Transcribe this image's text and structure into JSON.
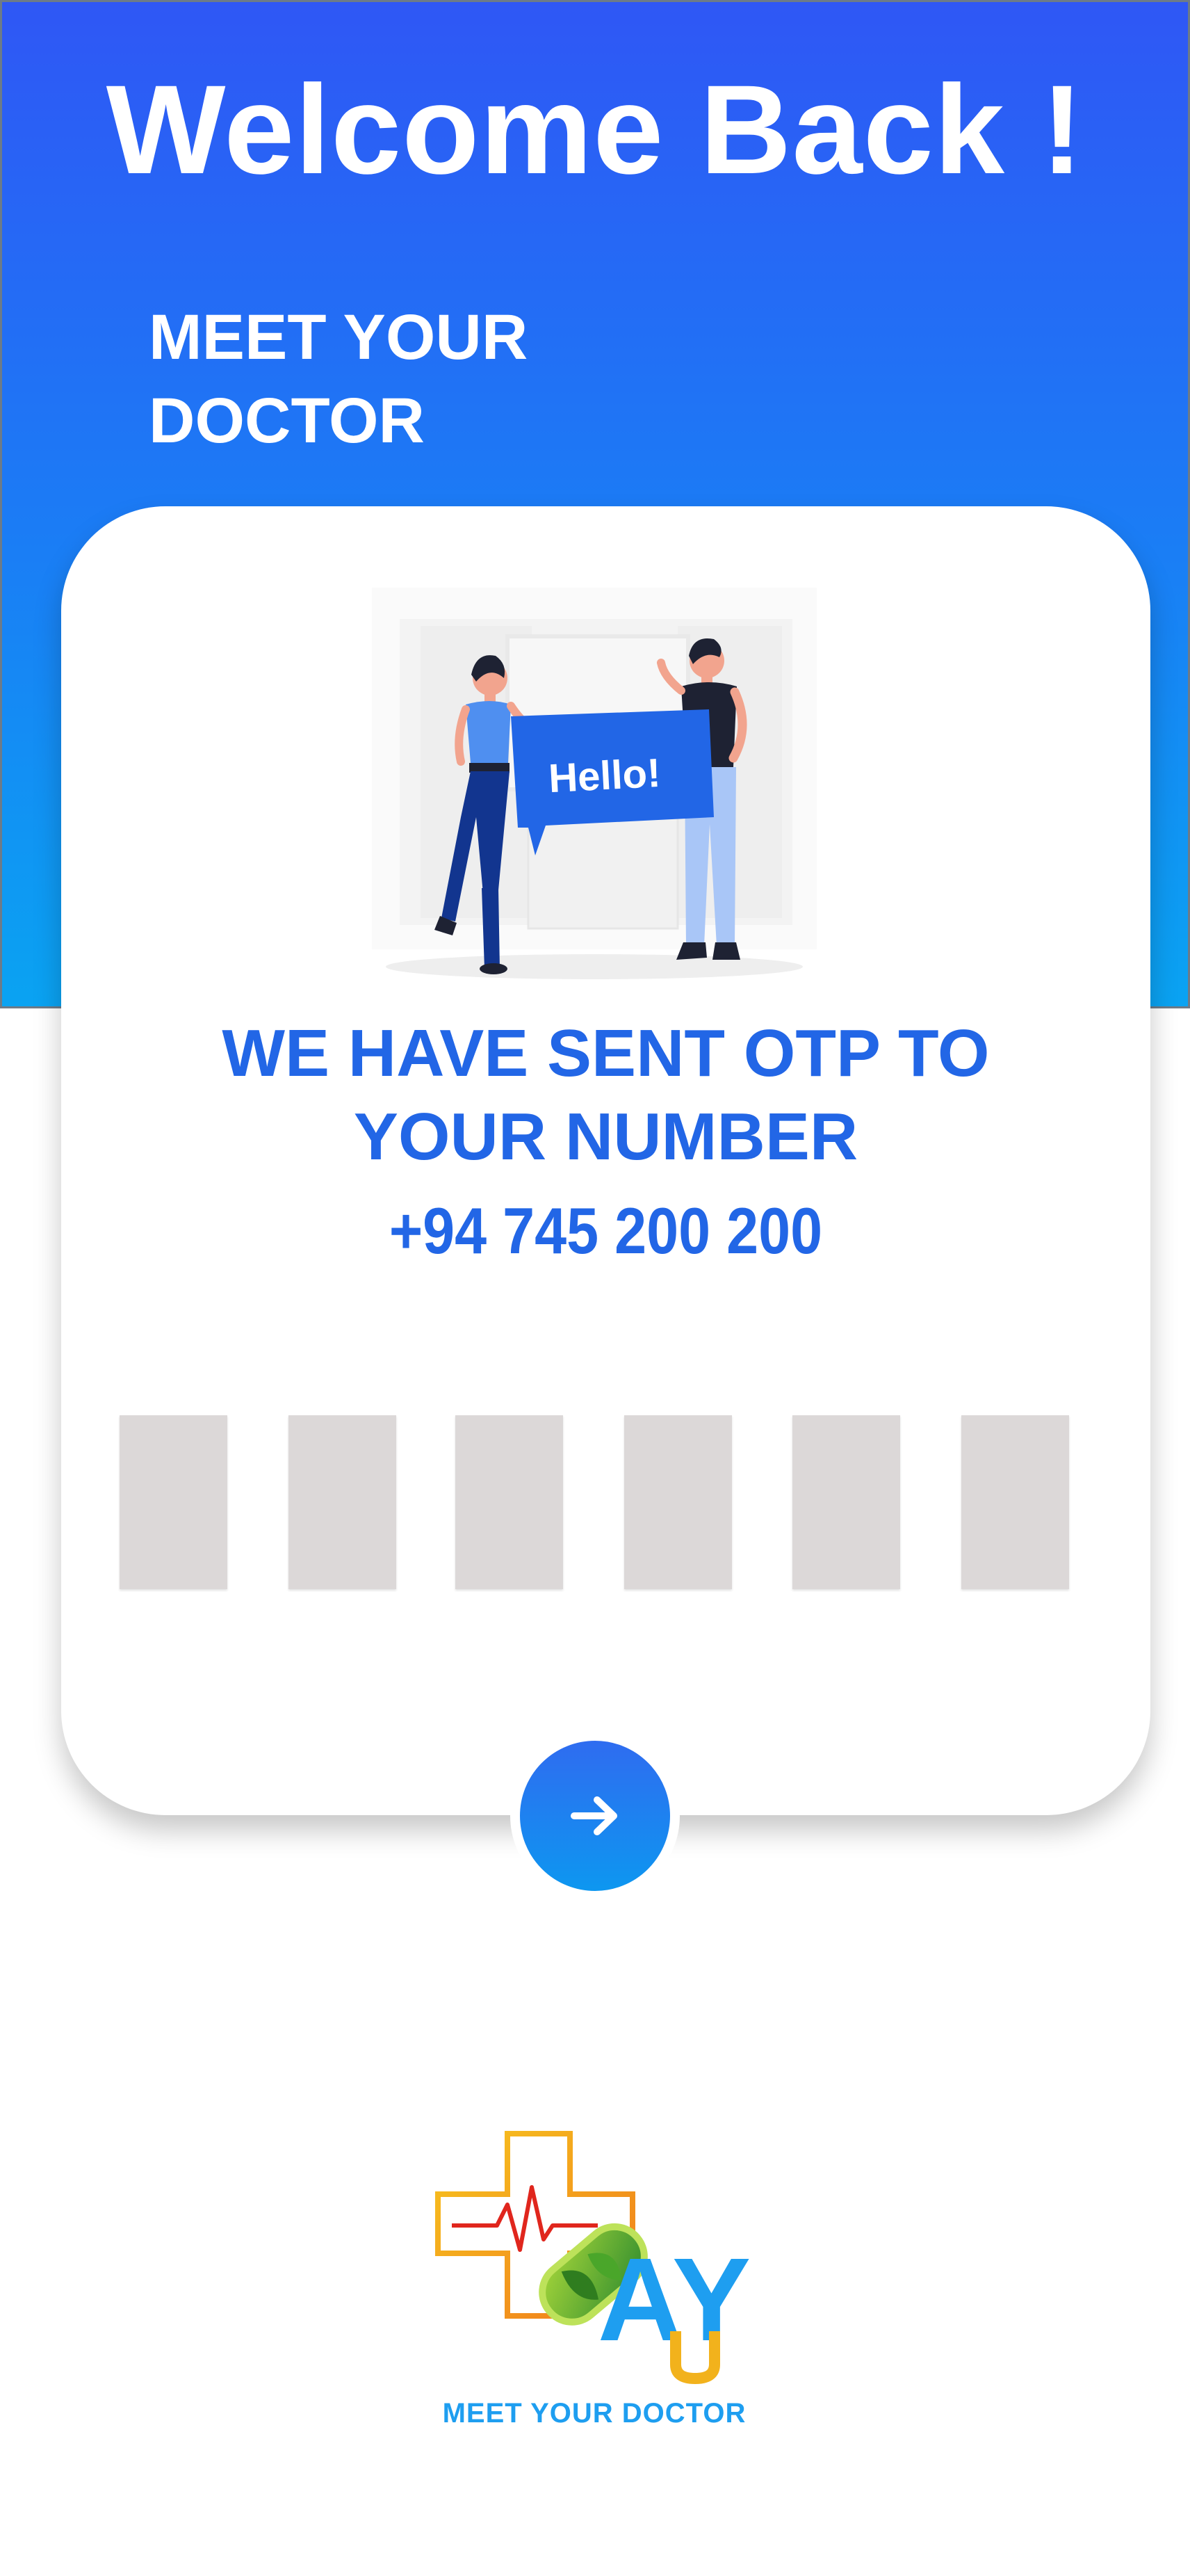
{
  "header": {
    "title": "Welcome Back !",
    "subtitle_line1": "MEET YOUR",
    "subtitle_line2": "DOCTOR"
  },
  "illustration": {
    "bubble_text": "Hello!",
    "icon": "people-greeting-illustration"
  },
  "otp": {
    "message_line1": "WE HAVE SENT OTP TO",
    "message_line2": "YOUR NUMBER",
    "phone": "+94 745 200 200",
    "digits": [
      "",
      "",
      "",
      "",
      "",
      ""
    ]
  },
  "actions": {
    "next_icon": "arrow-right-icon"
  },
  "brand": {
    "logo_letters": "AY",
    "tagline": "MEET YOUR DOCTOR"
  },
  "colors": {
    "primary": "#2266e6",
    "gradient_top": "#2f57f5",
    "gradient_bottom": "#0aa3f2",
    "otp_box": "#dcd8d8",
    "brand_text": "#1e9ef0"
  }
}
